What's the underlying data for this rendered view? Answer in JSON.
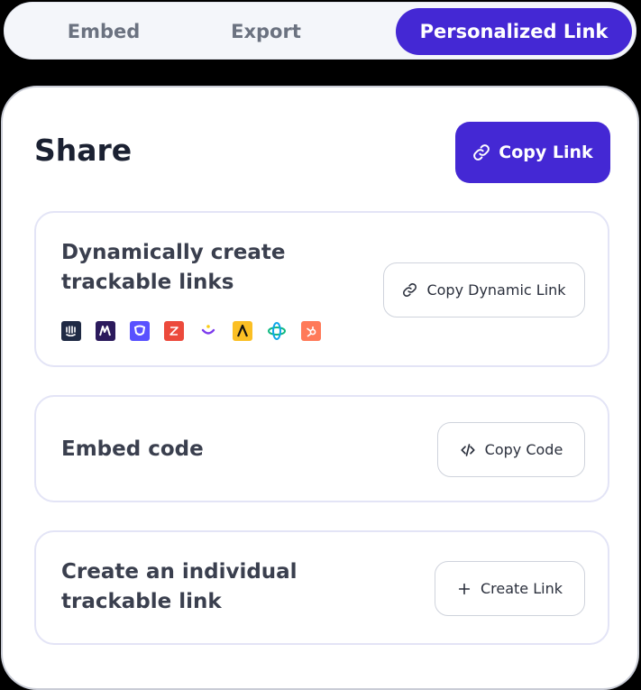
{
  "tabs": [
    {
      "label": "Embed",
      "active": false
    },
    {
      "label": "Export",
      "active": false
    },
    {
      "label": "Personalized Link",
      "active": true
    }
  ],
  "share": {
    "title": "Share",
    "copy_link_label": "Copy Link"
  },
  "cards": {
    "dynamic": {
      "title": "Dynamically create trackable links",
      "button_label": "Copy Dynamic Link",
      "integrations": [
        "intercom-logo",
        "marketo-logo",
        "outreach-logo",
        "zendesk-logo",
        "customer-io-logo",
        "apollo-logo",
        "salesloft-logo",
        "hubspot-logo"
      ]
    },
    "embed": {
      "title": "Embed code",
      "button_label": "Copy Code"
    },
    "individual": {
      "title": "Create an individual trackable link",
      "button_label": "Create Link"
    }
  },
  "colors": {
    "accent": "#4428d4",
    "title_text": "#1b2132",
    "card_border": "#e3e4f6"
  }
}
